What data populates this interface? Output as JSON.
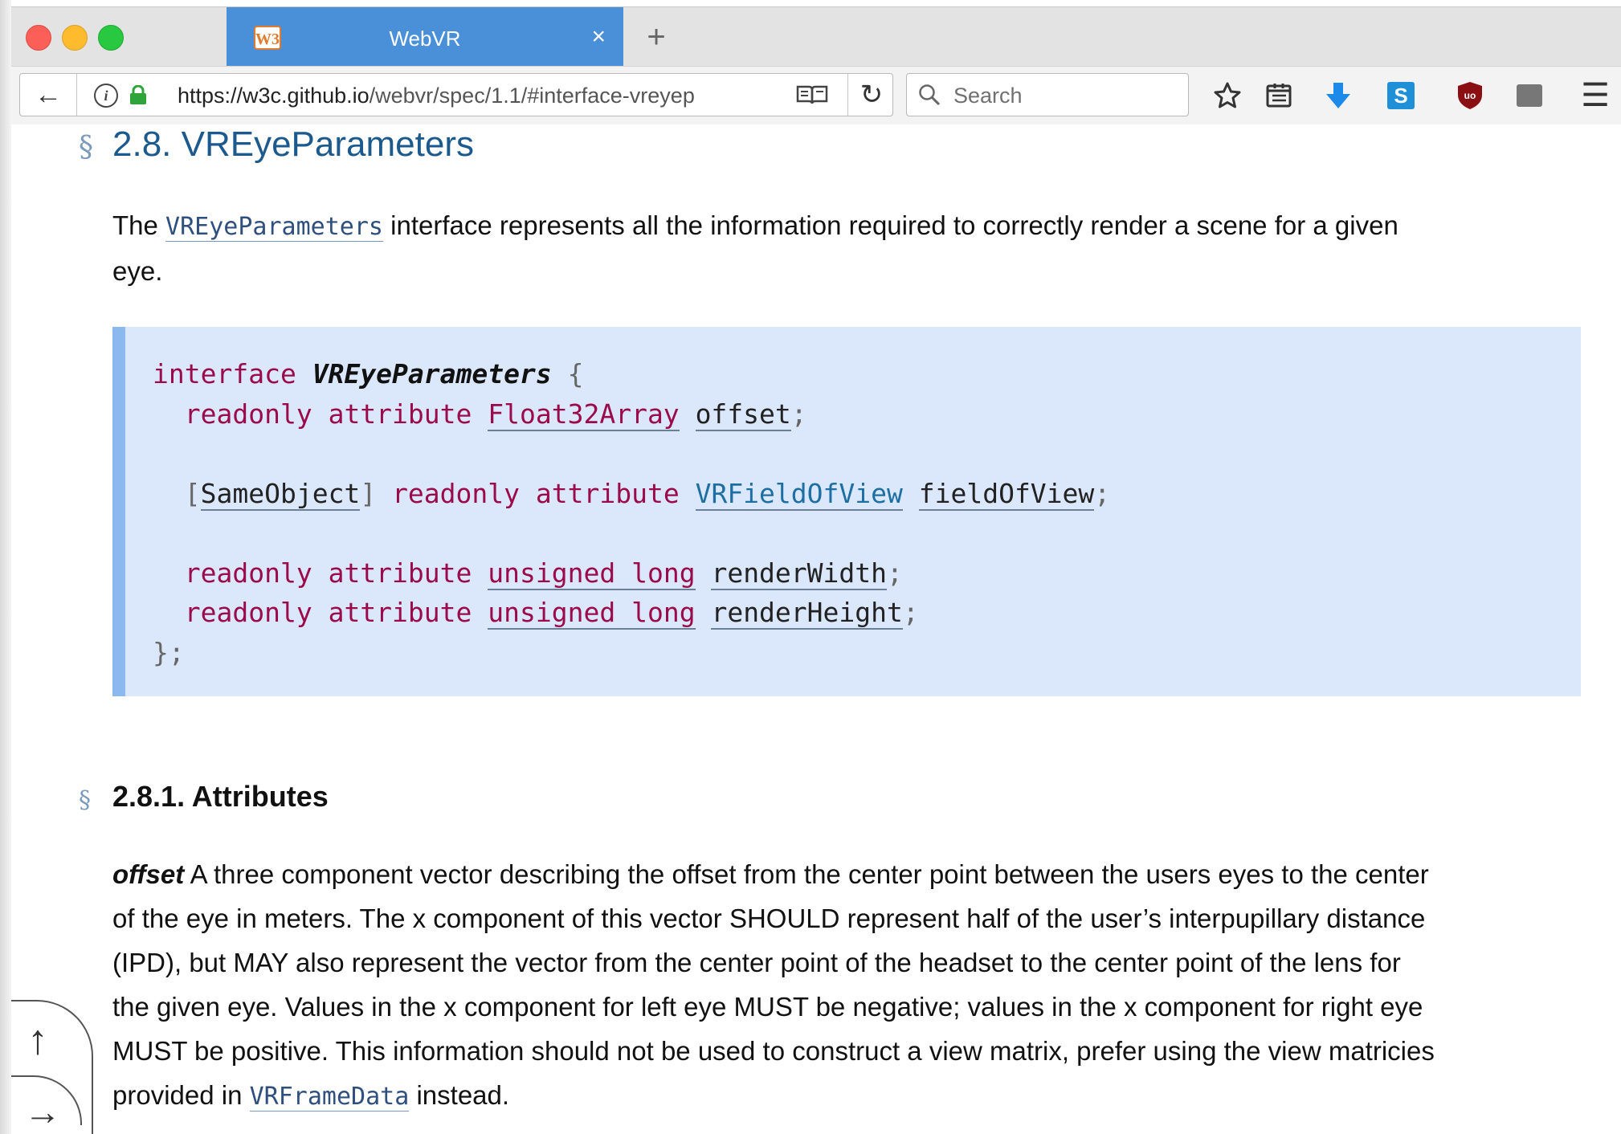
{
  "tab": {
    "favicon_text": "W3",
    "title": "WebVR",
    "close": "×",
    "new_tab": "+"
  },
  "toolbar": {
    "back": "←",
    "url_host": "https://w3c.github.io",
    "url_path": "/webvr/spec/1.1/#interface-vreyep",
    "reload": "↻",
    "search_placeholder": "Search",
    "menu": "☰"
  },
  "page": {
    "section_mark": "§",
    "heading": "2.8. VREyeParameters",
    "intro_before": "The ",
    "intro_code": "VREyeParameters",
    "intro_line1": " interface represents all the information required to correctly render a scene for a given",
    "intro_line2": "eye.",
    "idl": {
      "interface_kw": "interface",
      "interface_name": "VREyeParameters",
      "open_brace": " {",
      "readonly": "readonly",
      "attribute": "attribute",
      "float32array": "Float32Array",
      "offset": "offset",
      "same_object": "SameObject",
      "field_of_view_type": "VRFieldOfView",
      "field_of_view": "fieldOfView",
      "unsigned": "unsigned",
      "long": "long",
      "render_width": "renderWidth",
      "render_height": "renderHeight",
      "semicolon": ";",
      "lbracket": "[",
      "rbracket": "]",
      "close_brace": "};"
    },
    "attributes_heading": "2.8.1. Attributes",
    "offset_term": "offset",
    "offset_lines": [
      " A three component vector describing the offset from the center point between the users eyes to the center",
      "of the eye in meters. The x component of this vector SHOULD represent half of the user’s interpupillary distance",
      "(IPD), but MAY also represent the vector from the center point of the headset to the center point of the lens for",
      "the given eye. Values in the x component for left eye MUST be negative; values in the x component for right eye",
      "MUST be positive. This information should not be used to construct a view matrix, prefer using the view matricies"
    ],
    "offset_last_before": "provided in ",
    "offset_last_code": "VRFrameData",
    "offset_last_after": " instead."
  },
  "float_buttons": {
    "up": "↑",
    "right": "→"
  }
}
